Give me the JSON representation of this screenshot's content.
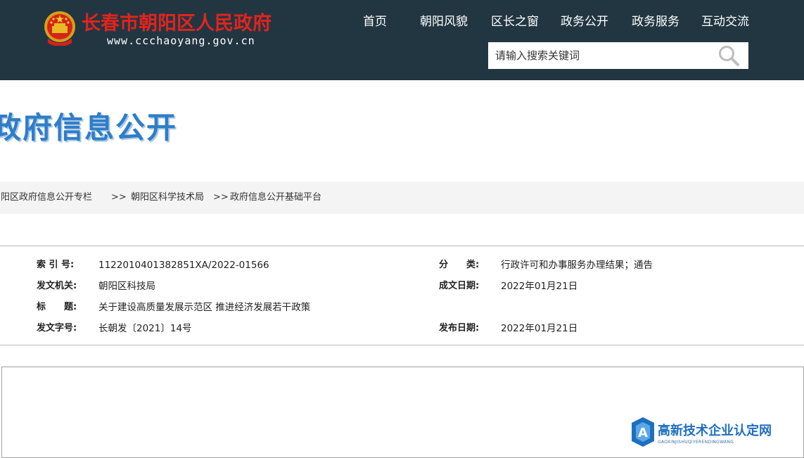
{
  "header": {
    "site_title": "长春市朝阳区人民政府",
    "site_url": "www.ccchaoyang.gov.cn",
    "nav": [
      "首页",
      "朝阳风貌",
      "区长之窗",
      "政务公开",
      "政务服务",
      "互动交流"
    ],
    "search_placeholder": "请输入搜索关键词"
  },
  "banner": {
    "title": "政府信息公开"
  },
  "breadcrumb": {
    "items": [
      "朝阳区政府信息公开专栏",
      "朝阳区科学技术局",
      "政府信息公开基础平台"
    ],
    "separator": ">>"
  },
  "info": {
    "index_label": "索 引 号:",
    "index_value": "1122010401382851XA/2022-01566",
    "category_label": "分　　类:",
    "category_value": "行政许可和办事服务办理结果；通告",
    "issuer_label": "发文机关:",
    "issuer_value": "朝阳区科技局",
    "created_label": "成文日期:",
    "created_value": "2022年01月21日",
    "title_label": "标　　题:",
    "title_value": "关于建设高质量发展示范区 推进经济发展若干政策",
    "docno_label": "发文字号:",
    "docno_value": "长朝发〔2021〕14号",
    "published_label": "发布日期:",
    "published_value": "2022年01月21日"
  },
  "watermark": {
    "text": "高新技术企业认定网",
    "sub": "GAOXINJISHUQIYERENDINGWANG"
  },
  "colors": {
    "header_bg": "#223642",
    "site_title": "#e0241d",
    "banner_title": "#2e7dc8",
    "breadcrumb_bg": "#f4f4f4"
  }
}
